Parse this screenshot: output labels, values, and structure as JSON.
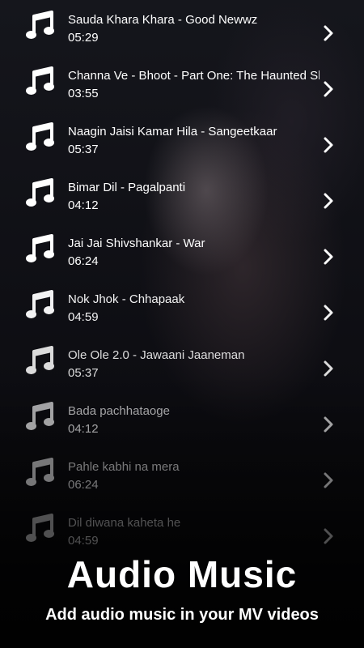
{
  "tracks": [
    {
      "title": "Sauda Khara Khara - Good Newwz",
      "duration": "05:29"
    },
    {
      "title": "Channa Ve - Bhoot - Part One: The Haunted Ship",
      "duration": "03:55"
    },
    {
      "title": "Naagin Jaisi Kamar Hila - Sangeetkaar",
      "duration": "05:37"
    },
    {
      "title": "Bimar Dil - Pagalpanti",
      "duration": "04:12"
    },
    {
      "title": "Jai Jai Shivshankar - War",
      "duration": "06:24"
    },
    {
      "title": "Nok Jhok - Chhapaak",
      "duration": "04:59"
    },
    {
      "title": "Ole Ole 2.0 - Jawaani Jaaneman",
      "duration": "05:37"
    },
    {
      "title": "Bada pachhataoge",
      "duration": "04:12"
    },
    {
      "title": "Pahle kabhi na mera",
      "duration": "06:24"
    },
    {
      "title": "Dil diwana kaheta he",
      "duration": "04:59"
    }
  ],
  "promo": {
    "headline": "Audio Music",
    "subtitle": "Add audio music in your MV videos"
  },
  "icons": {
    "track": "music-note-icon",
    "open": "chevron-right-icon"
  }
}
